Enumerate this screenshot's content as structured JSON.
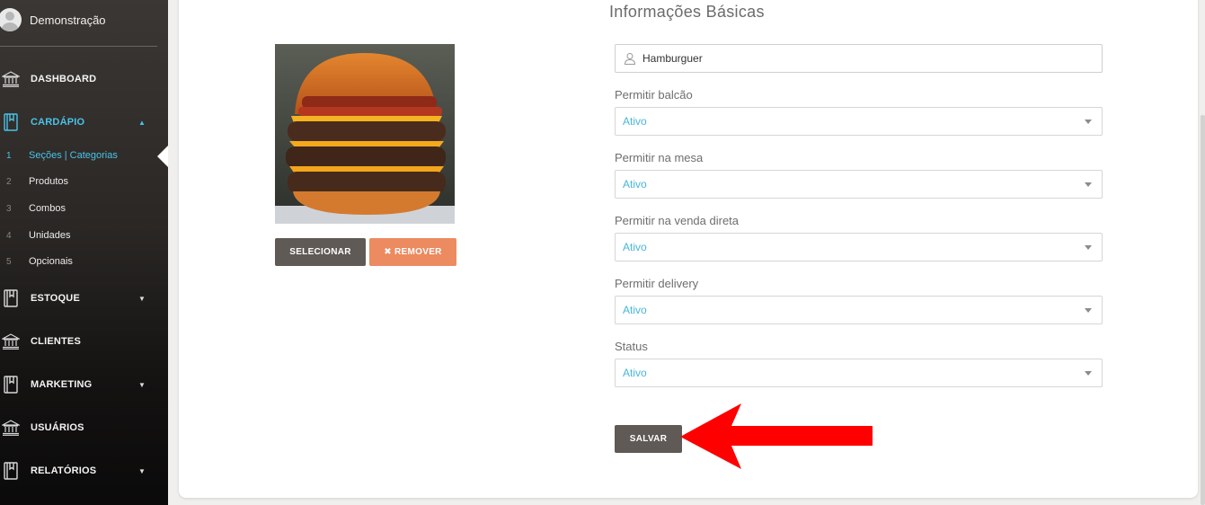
{
  "user": {
    "name": "Demonstração"
  },
  "nav": {
    "dashboard": "DASHBOARD",
    "cardapio": "CARDÁPIO",
    "submenu": [
      {
        "num": "1",
        "label": "Seções | Categorias"
      },
      {
        "num": "2",
        "label": "Produtos"
      },
      {
        "num": "3",
        "label": "Combos"
      },
      {
        "num": "4",
        "label": "Unidades"
      },
      {
        "num": "5",
        "label": "Opcionais"
      }
    ],
    "estoque": "ESTOQUE",
    "clientes": "CLIENTES",
    "marketing": "MARKETING",
    "usuarios": "USUÁRIOS",
    "relatorios": "RELATÓRIOS"
  },
  "form": {
    "title": "Informações Básicas",
    "name_value": "Hamburguer",
    "fields": [
      {
        "label": "Permitir balcão",
        "value": "Ativo"
      },
      {
        "label": "Permitir na mesa",
        "value": "Ativo"
      },
      {
        "label": "Permitir na venda direta",
        "value": "Ativo"
      },
      {
        "label": "Permitir delivery",
        "value": "Ativo"
      },
      {
        "label": "Status",
        "value": "Ativo"
      }
    ],
    "save_label": "SALVAR"
  },
  "image_buttons": {
    "select_label": "SELECIONAR",
    "remove_label": "✖ REMOVER"
  },
  "colors": {
    "accent": "#49c3e8",
    "primary_button": "#5f5a55",
    "remove_button": "#ec8a60",
    "arrow": "#ff0000"
  }
}
